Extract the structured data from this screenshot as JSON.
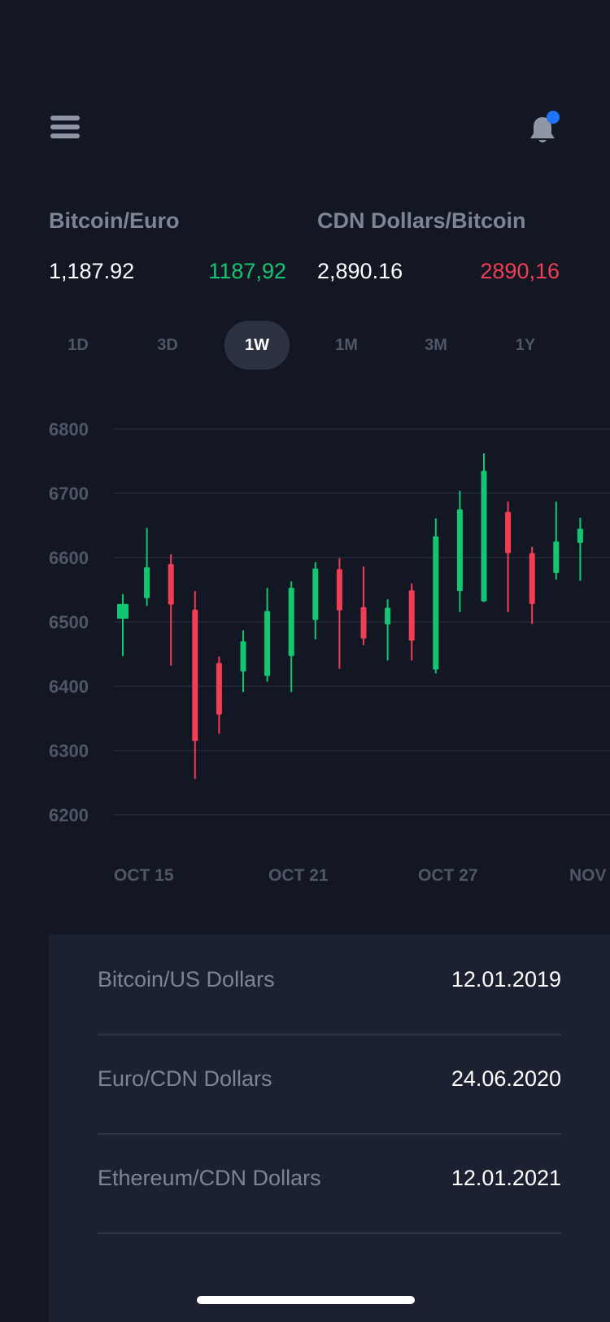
{
  "header": {
    "menu_icon": "hamburger-menu-icon",
    "bell_icon": "bell-icon",
    "notification_dot_color": "#1E74F6"
  },
  "pairs": [
    {
      "title": "Bitcoin/Euro",
      "value": "1,187.92",
      "alt_value": "1187,92",
      "alt_color": "#13C672"
    },
    {
      "title": "CDN Dollars/Bitcoin",
      "value": "2,890.16",
      "alt_value": "2890,16",
      "alt_color": "#F23D55"
    }
  ],
  "range_tabs": [
    {
      "label": "1D",
      "active": false
    },
    {
      "label": "3D",
      "active": false
    },
    {
      "label": "1W",
      "active": true
    },
    {
      "label": "1M",
      "active": false
    },
    {
      "label": "3M",
      "active": false
    },
    {
      "label": "1Y",
      "active": false
    }
  ],
  "chart_data": {
    "type": "candlestick",
    "y_ticks": [
      "6800",
      "6700",
      "6600",
      "6500",
      "6400",
      "6300",
      "6200"
    ],
    "ylim": [
      6200,
      6800
    ],
    "x_tick_labels": [
      "OCT  15",
      "OCT 21",
      "OCT 27",
      "NOV"
    ],
    "grid": true,
    "up_color": "#13C672",
    "down_color": "#F23D55",
    "candles": [
      {
        "open": 6505,
        "close": 6528,
        "high": 6543,
        "low": 6447
      },
      {
        "open": 6537,
        "close": 6585,
        "high": 6646,
        "low": 6525
      },
      {
        "open": 6590,
        "close": 6527,
        "high": 6605,
        "low": 6432
      },
      {
        "open": 6519,
        "close": 6315,
        "high": 6548,
        "low": 6256
      },
      {
        "open": 6436,
        "close": 6356,
        "high": 6446,
        "low": 6326
      },
      {
        "open": 6423,
        "close": 6470,
        "high": 6487,
        "low": 6391
      },
      {
        "open": 6416,
        "close": 6517,
        "high": 6553,
        "low": 6407
      },
      {
        "open": 6447,
        "close": 6553,
        "high": 6563,
        "low": 6391
      },
      {
        "open": 6503,
        "close": 6583,
        "high": 6593,
        "low": 6473
      },
      {
        "open": 6582,
        "close": 6518,
        "high": 6599,
        "low": 6427
      },
      {
        "open": 6523,
        "close": 6474,
        "high": 6586,
        "low": 6464
      },
      {
        "open": 6496,
        "close": 6522,
        "high": 6535,
        "low": 6440
      },
      {
        "open": 6549,
        "close": 6471,
        "high": 6560,
        "low": 6440
      },
      {
        "open": 6426,
        "close": 6633,
        "high": 6661,
        "low": 6420
      },
      {
        "open": 6548,
        "close": 6675,
        "high": 6704,
        "low": 6515
      },
      {
        "open": 6532,
        "close": 6735,
        "high": 6762,
        "low": 6531
      },
      {
        "open": 6671,
        "close": 6607,
        "high": 6687,
        "low": 6515
      },
      {
        "open": 6607,
        "close": 6528,
        "high": 6617,
        "low": 6497
      },
      {
        "open": 6576,
        "close": 6625,
        "high": 6687,
        "low": 6566
      },
      {
        "open": 6623,
        "close": 6645,
        "high": 6662,
        "low": 6564
      }
    ]
  },
  "history": [
    {
      "name": "Bitcoin/US Dollars",
      "date": "12.01.2019"
    },
    {
      "name": "Euro/CDN Dollars",
      "date": "24.06.2020"
    },
    {
      "name": "Ethereum/CDN Dollars",
      "date": "12.01.2021"
    }
  ]
}
